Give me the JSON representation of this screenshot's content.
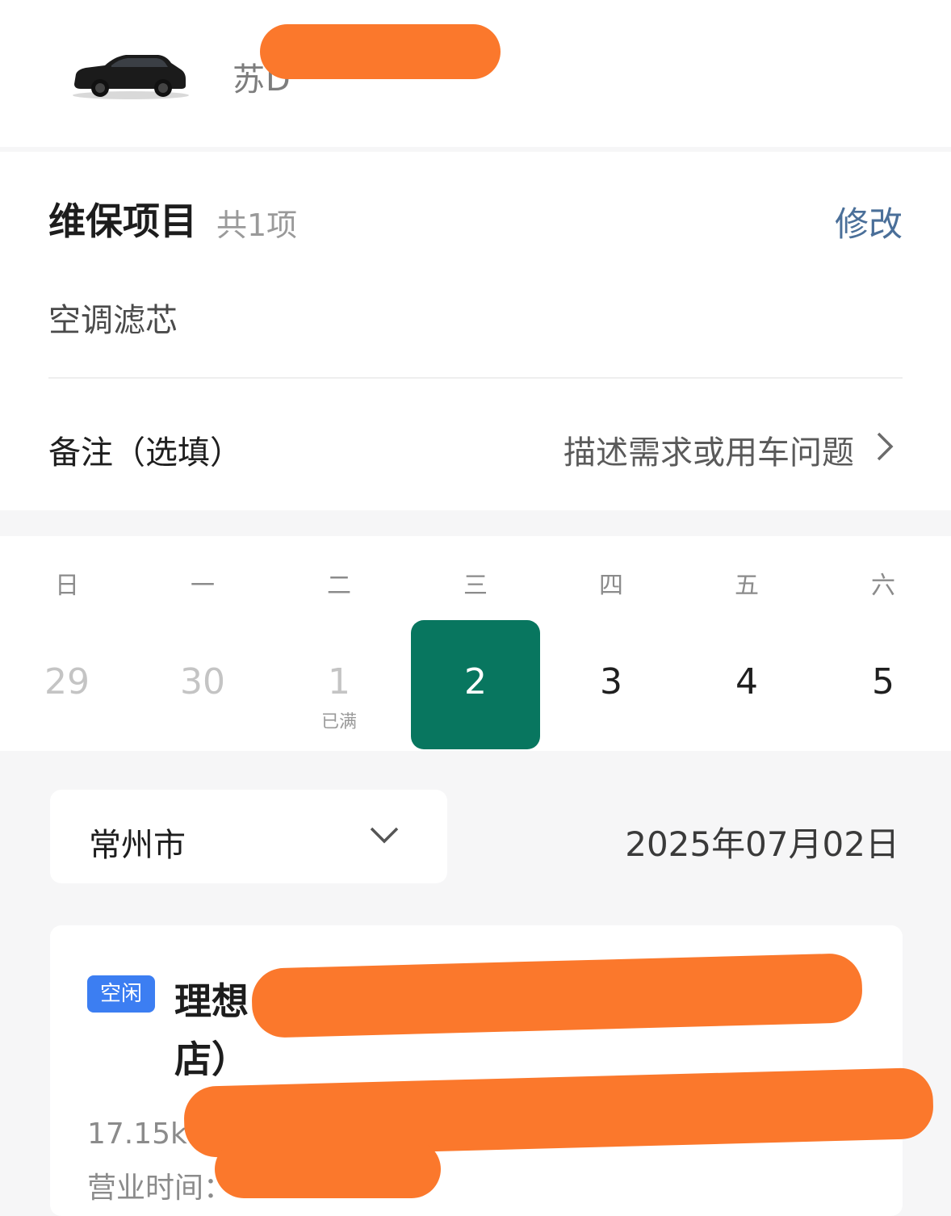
{
  "vehicle": {
    "plate": "苏D",
    "image": "black-suv-car"
  },
  "maintenance": {
    "title": "维保项目",
    "count": "共1项",
    "modify_label": "修改",
    "items": [
      "空调滤芯"
    ]
  },
  "remarks": {
    "label": "备注（选填）",
    "placeholder": "描述需求或用车问题",
    "icon": "chevron-right-icon"
  },
  "calendar": {
    "weekdays": [
      "日",
      "一",
      "二",
      "三",
      "四",
      "五",
      "六"
    ],
    "days": [
      {
        "num": "29",
        "state": "past",
        "note": ""
      },
      {
        "num": "30",
        "state": "past",
        "note": ""
      },
      {
        "num": "1",
        "state": "full",
        "note": "已满"
      },
      {
        "num": "2",
        "state": "selected",
        "note": ""
      },
      {
        "num": "3",
        "state": "available",
        "note": ""
      },
      {
        "num": "4",
        "state": "available",
        "note": ""
      },
      {
        "num": "5",
        "state": "available",
        "note": ""
      }
    ],
    "selected_color": "#08765f"
  },
  "location": {
    "city": "常州市",
    "date": "2025年07月02日"
  },
  "store": {
    "status": "空闲",
    "name_line1": "理想",
    "name_line2": "店）",
    "distance": "17.15km",
    "hours_label": "营业时间："
  },
  "colors": {
    "accent_link": "#4a6f99",
    "status_badge": "#3c7ef2",
    "redaction": "#fb782c"
  }
}
